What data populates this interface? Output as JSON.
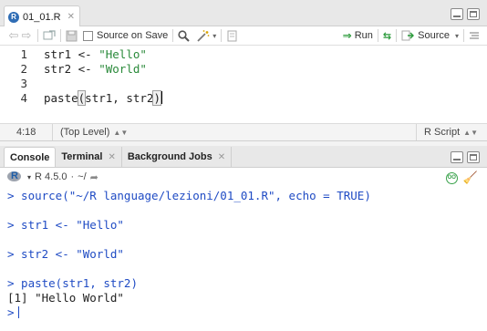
{
  "editor": {
    "tab_label": "01_01.R",
    "tab_icon": "R",
    "toolbar": {
      "source_on_save": "Source on Save",
      "run": "Run",
      "source": "Source"
    },
    "line_numbers": [
      "1",
      "2",
      "3",
      "4"
    ],
    "code": {
      "l1_var": "str1 <- ",
      "l1_str": "\"Hello\"",
      "l2_var": "str2 <- ",
      "l2_str": "\"World\"",
      "l4_fn": "paste",
      "l4_open": "(",
      "l4_args": "str1, str2",
      "l4_close": ")"
    },
    "status": {
      "position": "4:18",
      "scope": "(Top Level)",
      "file_type": "R Script"
    }
  },
  "console": {
    "tabs": [
      "Console",
      "Terminal",
      "Background Jobs"
    ],
    "r_version": "R 4.5.0",
    "working_dir": "~/",
    "output": {
      "l1": "> source(\"~/R language/lezioni/01_01.R\", echo = TRUE)",
      "l2": "> str1 <- \"Hello\"",
      "l3": "> str2 <- \"World\"",
      "l4": "> paste(str1, str2)",
      "l5": "[1] \"Hello World\"",
      "prompt": ">"
    }
  },
  "colors": {
    "string": "#2a8a3a",
    "console_input": "#1f4bc4"
  }
}
